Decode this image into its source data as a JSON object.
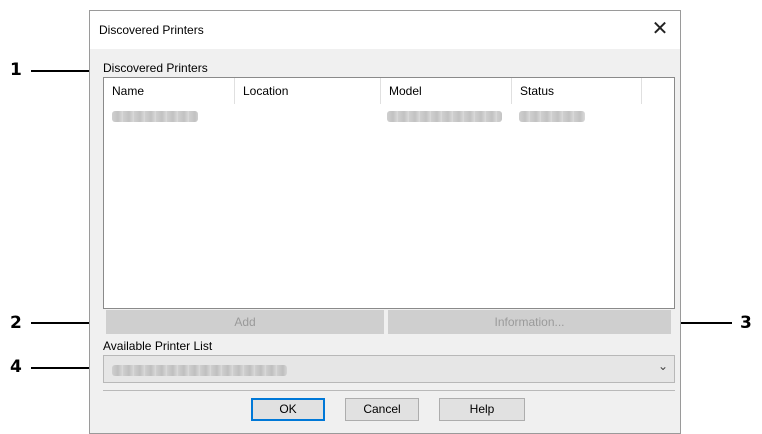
{
  "window": {
    "title": "Discovered Printers",
    "close_glyph": "✕"
  },
  "discovered": {
    "group_label": "Discovered Printers",
    "columns": [
      "Name",
      "Location",
      "Model",
      "Status"
    ],
    "rows_note": ""
  },
  "buttons": {
    "add": "Add",
    "information": "Information...",
    "ok": "OK",
    "cancel": "Cancel",
    "help": "Help"
  },
  "available": {
    "label": "Available Printer List",
    "chevron": "⌄"
  },
  "callouts": [
    "1",
    "2",
    "3",
    "4"
  ],
  "colors": {
    "accent": "#0078d7",
    "dialog_bg": "#f0f0f0",
    "disabled_button": "#cfcfcf"
  },
  "icons": {
    "close": "close-icon",
    "dropdown": "chevron-down-icon"
  }
}
